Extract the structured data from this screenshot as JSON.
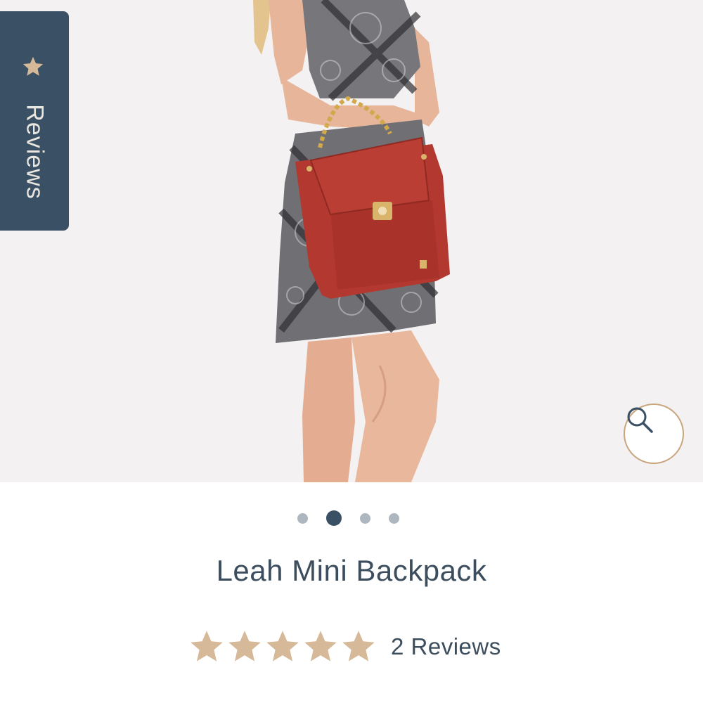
{
  "tabs": {
    "reviews_label": "Reviews"
  },
  "gallery": {
    "slide_count": 4,
    "active_slide": 2
  },
  "product": {
    "title": "Leah Mini Backpack",
    "rating": 5,
    "reviews_text": "2 Reviews"
  },
  "colors": {
    "accent": "#3a5165",
    "star": "#d6b998",
    "zoom_border": "#c9a57e",
    "bag": "#b3382f"
  },
  "icons": [
    "star-icon",
    "search-icon"
  ]
}
